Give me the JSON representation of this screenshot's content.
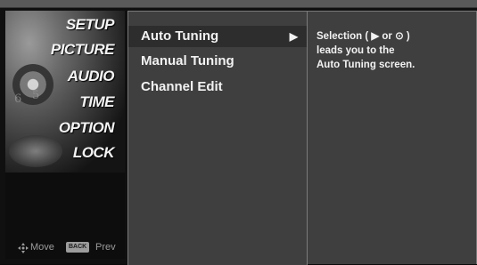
{
  "left_menu": {
    "items": [
      {
        "label": "SETUP",
        "icon": "satellite-dish-icon"
      },
      {
        "label": "PICTURE",
        "icon": "tv-picture-icon"
      },
      {
        "label": "AUDIO",
        "icon": "speaker-icon"
      },
      {
        "label": "TIME",
        "icon": "clock-icon"
      },
      {
        "label": "OPTION",
        "icon": "option-icon"
      },
      {
        "label": "LOCK",
        "icon": "lock-icon"
      }
    ]
  },
  "help": {
    "move_label": "Move",
    "back_badge": "BACK",
    "prev_label": "Prev"
  },
  "submenu": {
    "items": [
      {
        "label": "Auto Tuning",
        "selected": true,
        "arrow": "▶"
      },
      {
        "label": "Manual Tuning",
        "selected": false
      },
      {
        "label": "Channel Edit",
        "selected": false
      }
    ]
  },
  "description": {
    "lines": [
      "Selection ( ▶ or ⊙ )",
      "leads you to the",
      "Auto Tuning screen."
    ]
  },
  "colors": {
    "panel_bg": "#3f3f3f",
    "selected_bg": "#2d2d2d",
    "border": "#7a7a7a",
    "text": "#f2f2f2"
  }
}
